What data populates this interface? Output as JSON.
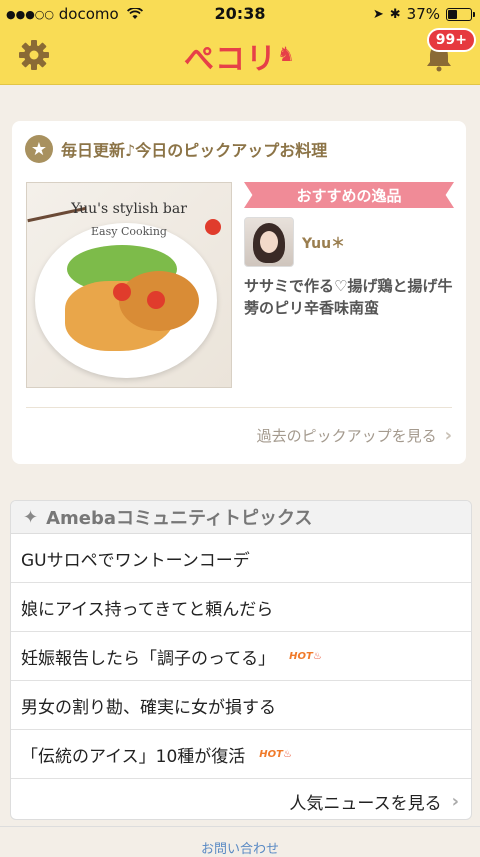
{
  "status_bar": {
    "carrier": "docomo",
    "time": "20:38",
    "battery": "37%",
    "battery_level": 0.37,
    "icons": [
      "signal-dots-icon",
      "wifi-icon",
      "location-arrow-icon",
      "bluetooth-icon",
      "battery-icon"
    ]
  },
  "header": {
    "logo": "ぺコリ",
    "badge_count": "99+",
    "icons": [
      "gear-icon",
      "notification-bell-icon"
    ],
    "brand_color": "#f9dc55",
    "logo_color": "#e64048"
  },
  "pickup": {
    "title": "毎日更新♪今日のピックアップお料理",
    "photo_caption_title": "Yuu's stylish bar",
    "photo_caption_sub": "Easy Cooking",
    "ribbon_label": "おすすめの逸品",
    "author": "Yuu＊",
    "recipe_title": "ササミで作る♡揚げ鶏と揚げ牛蒡のピリ辛香味南蛮",
    "past_link": "過去のピックアップを見る",
    "accent_color": "#8c7447",
    "ribbon_color": "#f08b97"
  },
  "community": {
    "title": "Amebaコミュニティトピックス",
    "topics": [
      {
        "text": "GUサロペでワントーンコーデ",
        "hot": ""
      },
      {
        "text": "娘にアイス持ってきてと頼んだら",
        "hot": ""
      },
      {
        "text": "妊娠報告したら「調子のってる」",
        "hot": "HOT"
      },
      {
        "text": "男女の割り勘、確実に女が損する",
        "hot": ""
      },
      {
        "text": "「伝統のアイス」10種が復活",
        "hot": "HOT"
      }
    ],
    "more_link": "人気ニュースを見る"
  },
  "footer": {
    "inquiry": "お問い合わせ"
  }
}
